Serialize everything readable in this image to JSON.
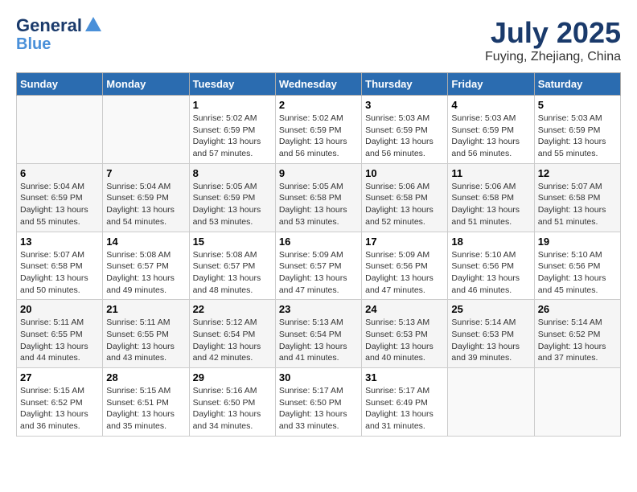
{
  "header": {
    "logo_general": "General",
    "logo_blue": "Blue",
    "month_year": "July 2025",
    "location": "Fuying, Zhejiang, China"
  },
  "days_of_week": [
    "Sunday",
    "Monday",
    "Tuesday",
    "Wednesday",
    "Thursday",
    "Friday",
    "Saturday"
  ],
  "weeks": [
    [
      {
        "day": "",
        "info": ""
      },
      {
        "day": "",
        "info": ""
      },
      {
        "day": "1",
        "info": "Sunrise: 5:02 AM\nSunset: 6:59 PM\nDaylight: 13 hours and 57 minutes."
      },
      {
        "day": "2",
        "info": "Sunrise: 5:02 AM\nSunset: 6:59 PM\nDaylight: 13 hours and 56 minutes."
      },
      {
        "day": "3",
        "info": "Sunrise: 5:03 AM\nSunset: 6:59 PM\nDaylight: 13 hours and 56 minutes."
      },
      {
        "day": "4",
        "info": "Sunrise: 5:03 AM\nSunset: 6:59 PM\nDaylight: 13 hours and 56 minutes."
      },
      {
        "day": "5",
        "info": "Sunrise: 5:03 AM\nSunset: 6:59 PM\nDaylight: 13 hours and 55 minutes."
      }
    ],
    [
      {
        "day": "6",
        "info": "Sunrise: 5:04 AM\nSunset: 6:59 PM\nDaylight: 13 hours and 55 minutes."
      },
      {
        "day": "7",
        "info": "Sunrise: 5:04 AM\nSunset: 6:59 PM\nDaylight: 13 hours and 54 minutes."
      },
      {
        "day": "8",
        "info": "Sunrise: 5:05 AM\nSunset: 6:59 PM\nDaylight: 13 hours and 53 minutes."
      },
      {
        "day": "9",
        "info": "Sunrise: 5:05 AM\nSunset: 6:58 PM\nDaylight: 13 hours and 53 minutes."
      },
      {
        "day": "10",
        "info": "Sunrise: 5:06 AM\nSunset: 6:58 PM\nDaylight: 13 hours and 52 minutes."
      },
      {
        "day": "11",
        "info": "Sunrise: 5:06 AM\nSunset: 6:58 PM\nDaylight: 13 hours and 51 minutes."
      },
      {
        "day": "12",
        "info": "Sunrise: 5:07 AM\nSunset: 6:58 PM\nDaylight: 13 hours and 51 minutes."
      }
    ],
    [
      {
        "day": "13",
        "info": "Sunrise: 5:07 AM\nSunset: 6:58 PM\nDaylight: 13 hours and 50 minutes."
      },
      {
        "day": "14",
        "info": "Sunrise: 5:08 AM\nSunset: 6:57 PM\nDaylight: 13 hours and 49 minutes."
      },
      {
        "day": "15",
        "info": "Sunrise: 5:08 AM\nSunset: 6:57 PM\nDaylight: 13 hours and 48 minutes."
      },
      {
        "day": "16",
        "info": "Sunrise: 5:09 AM\nSunset: 6:57 PM\nDaylight: 13 hours and 47 minutes."
      },
      {
        "day": "17",
        "info": "Sunrise: 5:09 AM\nSunset: 6:56 PM\nDaylight: 13 hours and 47 minutes."
      },
      {
        "day": "18",
        "info": "Sunrise: 5:10 AM\nSunset: 6:56 PM\nDaylight: 13 hours and 46 minutes."
      },
      {
        "day": "19",
        "info": "Sunrise: 5:10 AM\nSunset: 6:56 PM\nDaylight: 13 hours and 45 minutes."
      }
    ],
    [
      {
        "day": "20",
        "info": "Sunrise: 5:11 AM\nSunset: 6:55 PM\nDaylight: 13 hours and 44 minutes."
      },
      {
        "day": "21",
        "info": "Sunrise: 5:11 AM\nSunset: 6:55 PM\nDaylight: 13 hours and 43 minutes."
      },
      {
        "day": "22",
        "info": "Sunrise: 5:12 AM\nSunset: 6:54 PM\nDaylight: 13 hours and 42 minutes."
      },
      {
        "day": "23",
        "info": "Sunrise: 5:13 AM\nSunset: 6:54 PM\nDaylight: 13 hours and 41 minutes."
      },
      {
        "day": "24",
        "info": "Sunrise: 5:13 AM\nSunset: 6:53 PM\nDaylight: 13 hours and 40 minutes."
      },
      {
        "day": "25",
        "info": "Sunrise: 5:14 AM\nSunset: 6:53 PM\nDaylight: 13 hours and 39 minutes."
      },
      {
        "day": "26",
        "info": "Sunrise: 5:14 AM\nSunset: 6:52 PM\nDaylight: 13 hours and 37 minutes."
      }
    ],
    [
      {
        "day": "27",
        "info": "Sunrise: 5:15 AM\nSunset: 6:52 PM\nDaylight: 13 hours and 36 minutes."
      },
      {
        "day": "28",
        "info": "Sunrise: 5:15 AM\nSunset: 6:51 PM\nDaylight: 13 hours and 35 minutes."
      },
      {
        "day": "29",
        "info": "Sunrise: 5:16 AM\nSunset: 6:50 PM\nDaylight: 13 hours and 34 minutes."
      },
      {
        "day": "30",
        "info": "Sunrise: 5:17 AM\nSunset: 6:50 PM\nDaylight: 13 hours and 33 minutes."
      },
      {
        "day": "31",
        "info": "Sunrise: 5:17 AM\nSunset: 6:49 PM\nDaylight: 13 hours and 31 minutes."
      },
      {
        "day": "",
        "info": ""
      },
      {
        "day": "",
        "info": ""
      }
    ]
  ]
}
